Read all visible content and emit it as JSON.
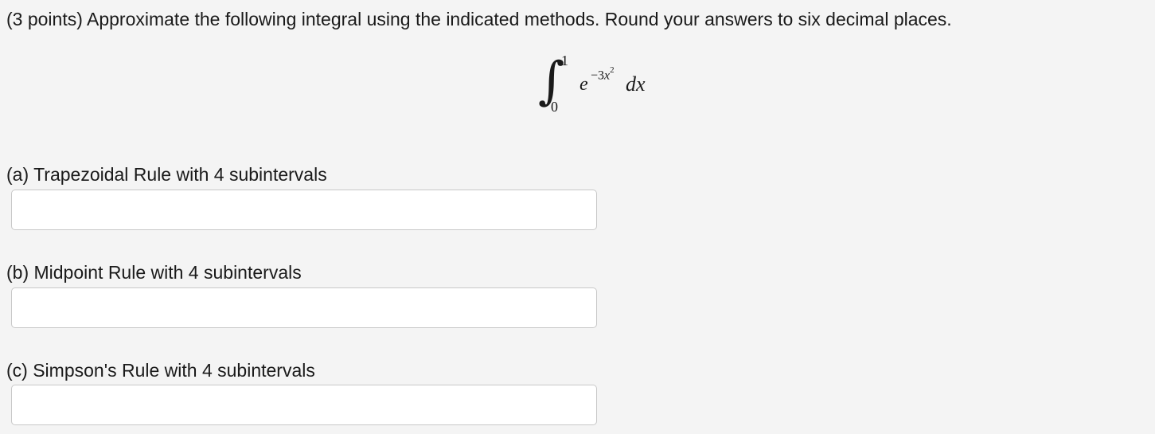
{
  "question": {
    "text": "(3 points) Approximate the following integral using the indicated methods. Round your answers to six decimal places."
  },
  "integral": {
    "upper_limit": "1",
    "lower_limit": "0",
    "base": "e",
    "exponent_sign": "−3",
    "exponent_var": "x",
    "exponent_power": "2",
    "differential": "dx"
  },
  "parts": [
    {
      "label": "(a) Trapezoidal Rule with 4 subintervals",
      "answer_value": "",
      "placeholder": ""
    },
    {
      "label": "(b) Midpoint Rule with 4 subintervals",
      "answer_value": "",
      "placeholder": ""
    },
    {
      "label": "(c) Simpson's Rule with 4 subintervals",
      "answer_value": "",
      "placeholder": ""
    }
  ],
  "colors": {
    "background": "#f4f4f4",
    "text": "#1a1a1a",
    "input_border": "#c8c8c8",
    "input_background": "#ffffff"
  }
}
